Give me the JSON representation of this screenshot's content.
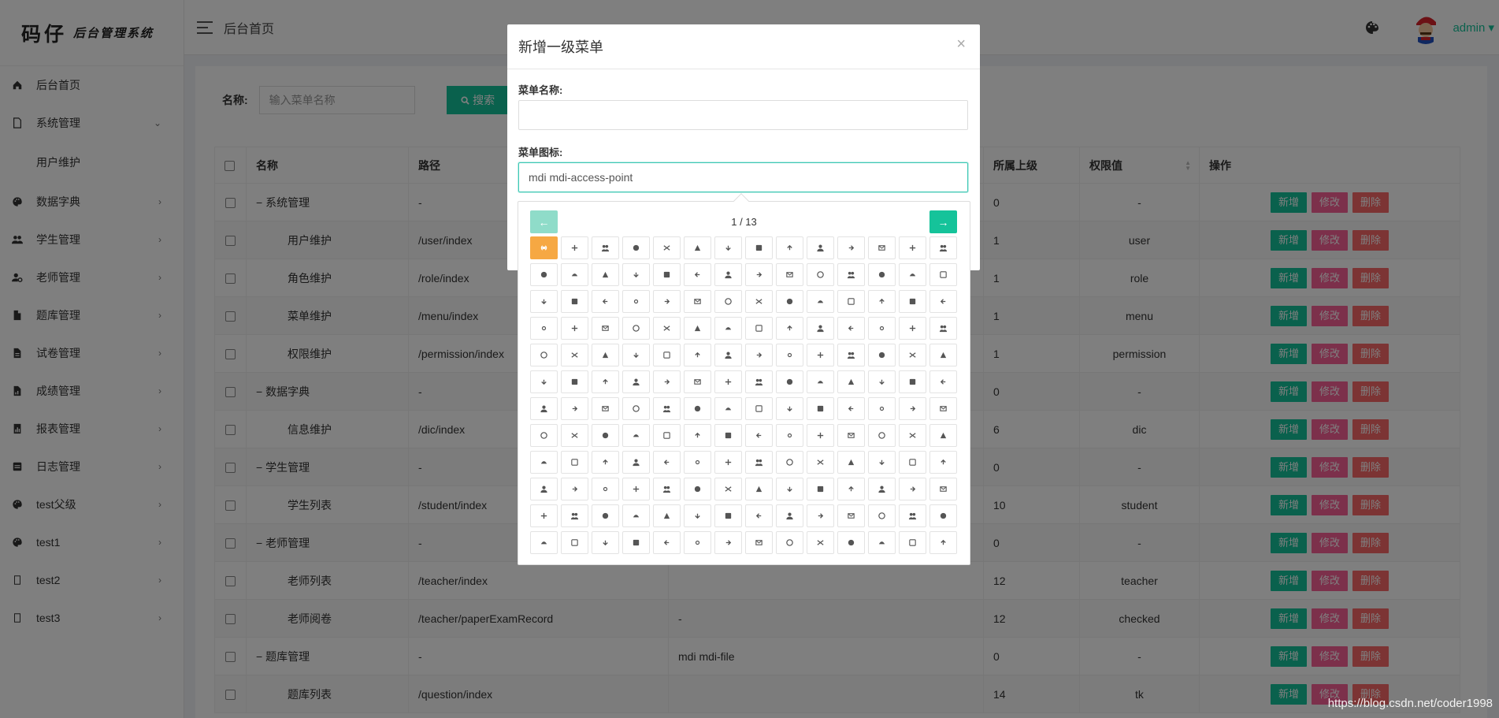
{
  "logo": {
    "main": "码仔",
    "sub": "后台管理系统"
  },
  "sidebar": {
    "items": [
      {
        "label": "后台首页",
        "icon": "home-icon",
        "arrow": ""
      },
      {
        "label": "系统管理",
        "icon": "file-icon",
        "arrow": "⌄"
      },
      {
        "label": "用户维护",
        "icon": "",
        "arrow": ""
      },
      {
        "label": "数据字典",
        "icon": "palette-icon",
        "arrow": "›"
      },
      {
        "label": "学生管理",
        "icon": "group-icon",
        "arrow": "›"
      },
      {
        "label": "老师管理",
        "icon": "person-gear-icon",
        "arrow": "›"
      },
      {
        "label": "题库管理",
        "icon": "document-icon",
        "arrow": "›"
      },
      {
        "label": "试卷管理",
        "icon": "document-lines-icon",
        "arrow": "›"
      },
      {
        "label": "成绩管理",
        "icon": "document-chart-icon",
        "arrow": "›"
      },
      {
        "label": "报表管理",
        "icon": "report-icon",
        "arrow": "›"
      },
      {
        "label": "日志管理",
        "icon": "log-icon",
        "arrow": "›"
      },
      {
        "label": "test父级",
        "icon": "palette-icon",
        "arrow": "›"
      },
      {
        "label": "test1",
        "icon": "palette-icon",
        "arrow": "›"
      },
      {
        "label": "test2",
        "icon": "blank-doc-icon",
        "arrow": "›"
      },
      {
        "label": "test3",
        "icon": "blank-doc-icon",
        "arrow": "›"
      }
    ]
  },
  "header": {
    "breadcrumb": "后台首页",
    "user": "admin"
  },
  "search": {
    "label": "名称:",
    "placeholder": "输入菜单名称",
    "button": "搜索"
  },
  "table": {
    "headers": [
      "名称",
      "路径",
      "所属上级",
      "权限值",
      "操作"
    ],
    "rows": [
      {
        "name": "− 系统管理",
        "path": "-",
        "icon": "",
        "parent": "0",
        "perm": "-",
        "child": false
      },
      {
        "name": "用户维护",
        "path": "/user/index",
        "icon": "",
        "parent": "1",
        "perm": "user",
        "child": true
      },
      {
        "name": "角色维护",
        "path": "/role/index",
        "icon": "",
        "parent": "1",
        "perm": "role",
        "child": true
      },
      {
        "name": "菜单维护",
        "path": "/menu/index",
        "icon": "",
        "parent": "1",
        "perm": "menu",
        "child": true
      },
      {
        "name": "权限维护",
        "path": "/permission/index",
        "icon": "",
        "parent": "1",
        "perm": "permission",
        "child": true
      },
      {
        "name": "− 数据字典",
        "path": "-",
        "icon": "",
        "parent": "0",
        "perm": "-",
        "child": false
      },
      {
        "name": "信息维护",
        "path": "/dic/index",
        "icon": "",
        "parent": "6",
        "perm": "dic",
        "child": true
      },
      {
        "name": "− 学生管理",
        "path": "-",
        "icon": "",
        "parent": "0",
        "perm": "-",
        "child": false
      },
      {
        "name": "学生列表",
        "path": "/student/index",
        "icon": "",
        "parent": "10",
        "perm": "student",
        "child": true
      },
      {
        "name": "− 老师管理",
        "path": "-",
        "icon": "",
        "parent": "0",
        "perm": "-",
        "child": false
      },
      {
        "name": "老师列表",
        "path": "/teacher/index",
        "icon": "",
        "parent": "12",
        "perm": "teacher",
        "child": true
      },
      {
        "name": "老师阅卷",
        "path": "/teacher/paperExamRecord",
        "icon": "-",
        "parent": "12",
        "perm": "checked",
        "child": true
      },
      {
        "name": "− 题库管理",
        "path": "-",
        "icon": "mdi mdi-file",
        "parent": "0",
        "perm": "-",
        "child": false
      },
      {
        "name": "题库列表",
        "path": "/question/index",
        "icon": "",
        "parent": "14",
        "perm": "tk",
        "child": true
      }
    ],
    "actions": {
      "add": "新增",
      "edit": "修改",
      "del": "删除"
    }
  },
  "modal": {
    "title": "新增一级菜单",
    "close": "×",
    "name_label": "菜单名称:",
    "name_value": "",
    "icon_label": "菜单图标:",
    "icon_value": "mdi mdi-access-point"
  },
  "picker": {
    "page": "1 / 13",
    "prev": "←",
    "next": "→"
  },
  "watermark": "https://blog.csdn.net/coder1998",
  "colors": {
    "accent": "#15c39a",
    "edit": "#f96197",
    "delete": "#f96868",
    "selected_icon": "#f6a843"
  }
}
